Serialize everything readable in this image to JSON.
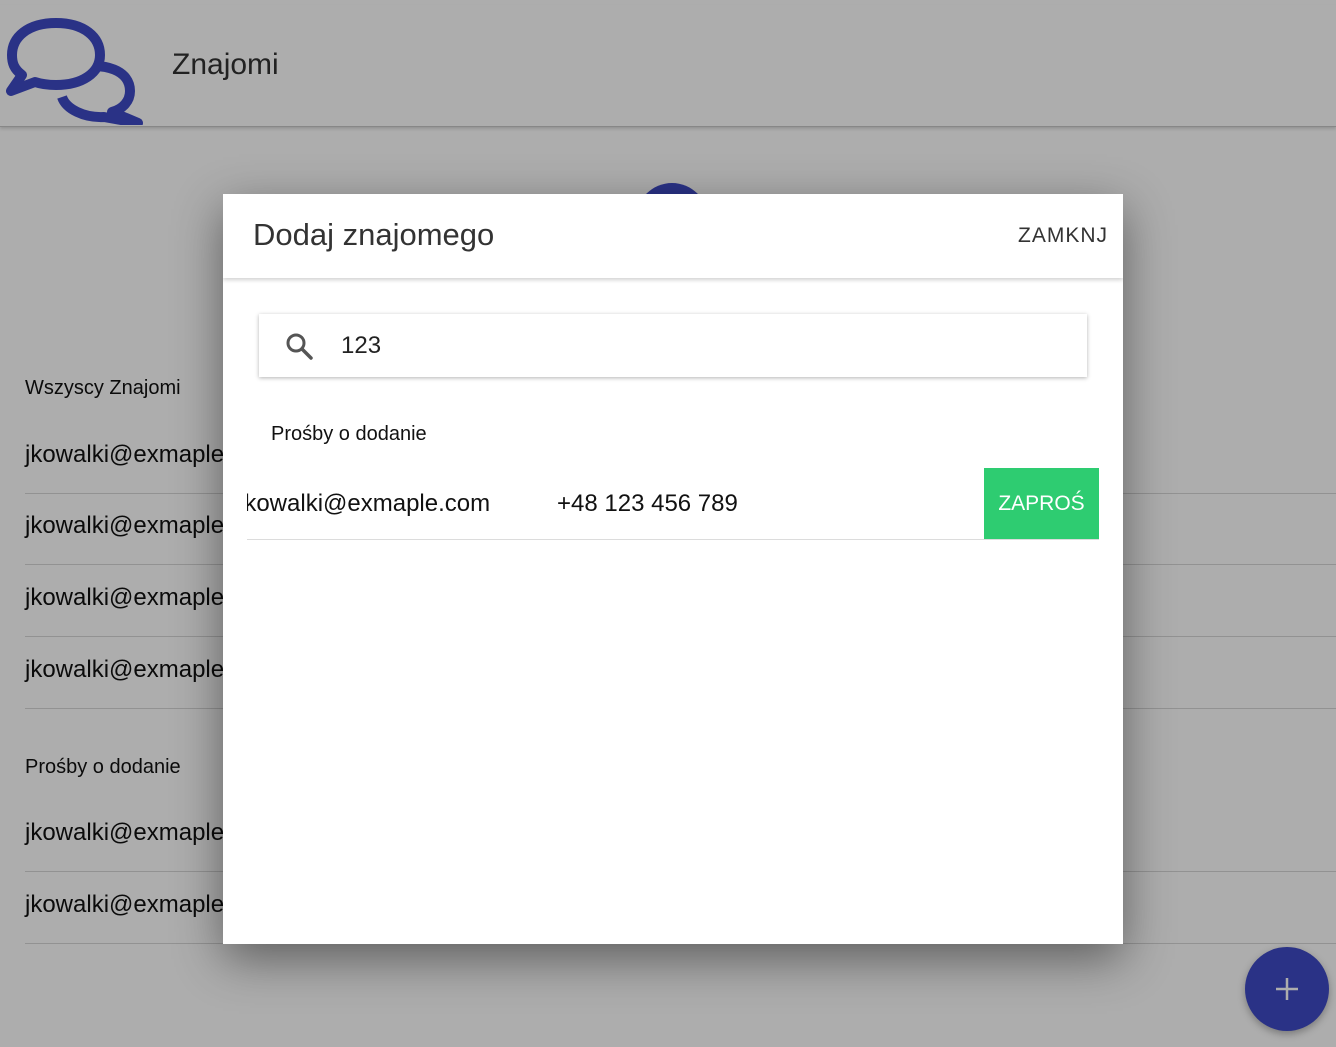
{
  "app": {
    "title": "Znajomi"
  },
  "friends": {
    "all_label": "Wszyscy Znajomi",
    "all": [
      "jkowalki@exmaple.com",
      "jkowalki@exmaple.com",
      "jkowalki@exmaple.com",
      "jkowalki@exmaple.com"
    ],
    "requests_label": "Prośby o dodanie",
    "requests": [
      "jkowalki@exmaple.com",
      "jkowalki@exmaple.com"
    ]
  },
  "fab": {
    "icon": "plus-icon"
  },
  "dialog": {
    "title": "Dodaj znajomego",
    "close_label": "ZAMKNJ",
    "search": {
      "value": "123",
      "icon": "search-icon"
    },
    "section_label": "Prośby o dodanie",
    "results": [
      {
        "email": "jkowalki@exmaple.com",
        "phone": "+48 123 456 789",
        "action": "ZAPROŚ"
      }
    ]
  },
  "colors": {
    "primary": "#3f4ac6",
    "invite": "#2ecc71",
    "backdrop": "rgba(0,0,0,0.32)"
  }
}
